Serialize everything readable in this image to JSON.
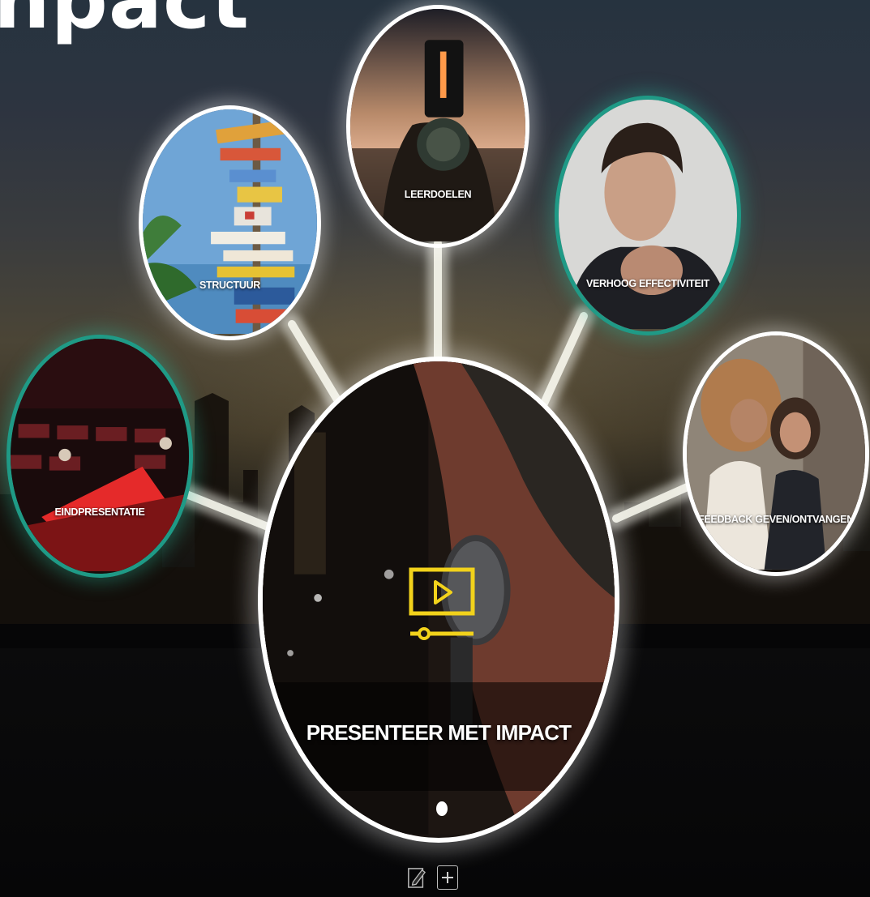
{
  "page": {
    "title": "npact"
  },
  "center": {
    "title": "PRESENTEER MET IMPACT",
    "icon": "video-play-icon",
    "icon_color": "#f2d21b"
  },
  "nodes": [
    {
      "id": "structuur",
      "label": "STRUCTUUR",
      "border": "#ffffff"
    },
    {
      "id": "leerdoelen",
      "label": "LEERDOELEN",
      "border": "#ffffff"
    },
    {
      "id": "verhoog",
      "label": "VERHOOG EFFECTIVITEIT",
      "border": "#1f9a86"
    },
    {
      "id": "eindpresentatie",
      "label": "EINDPRESENTATIE",
      "border": "#1f9a86"
    },
    {
      "id": "feedback",
      "label": "FEEDBACK GEVEN/ONTVANGEN",
      "border": "#ffffff"
    }
  ],
  "toolbar": {
    "edit_icon": "pencil-edit-icon",
    "add_icon": "plus-box-icon"
  }
}
